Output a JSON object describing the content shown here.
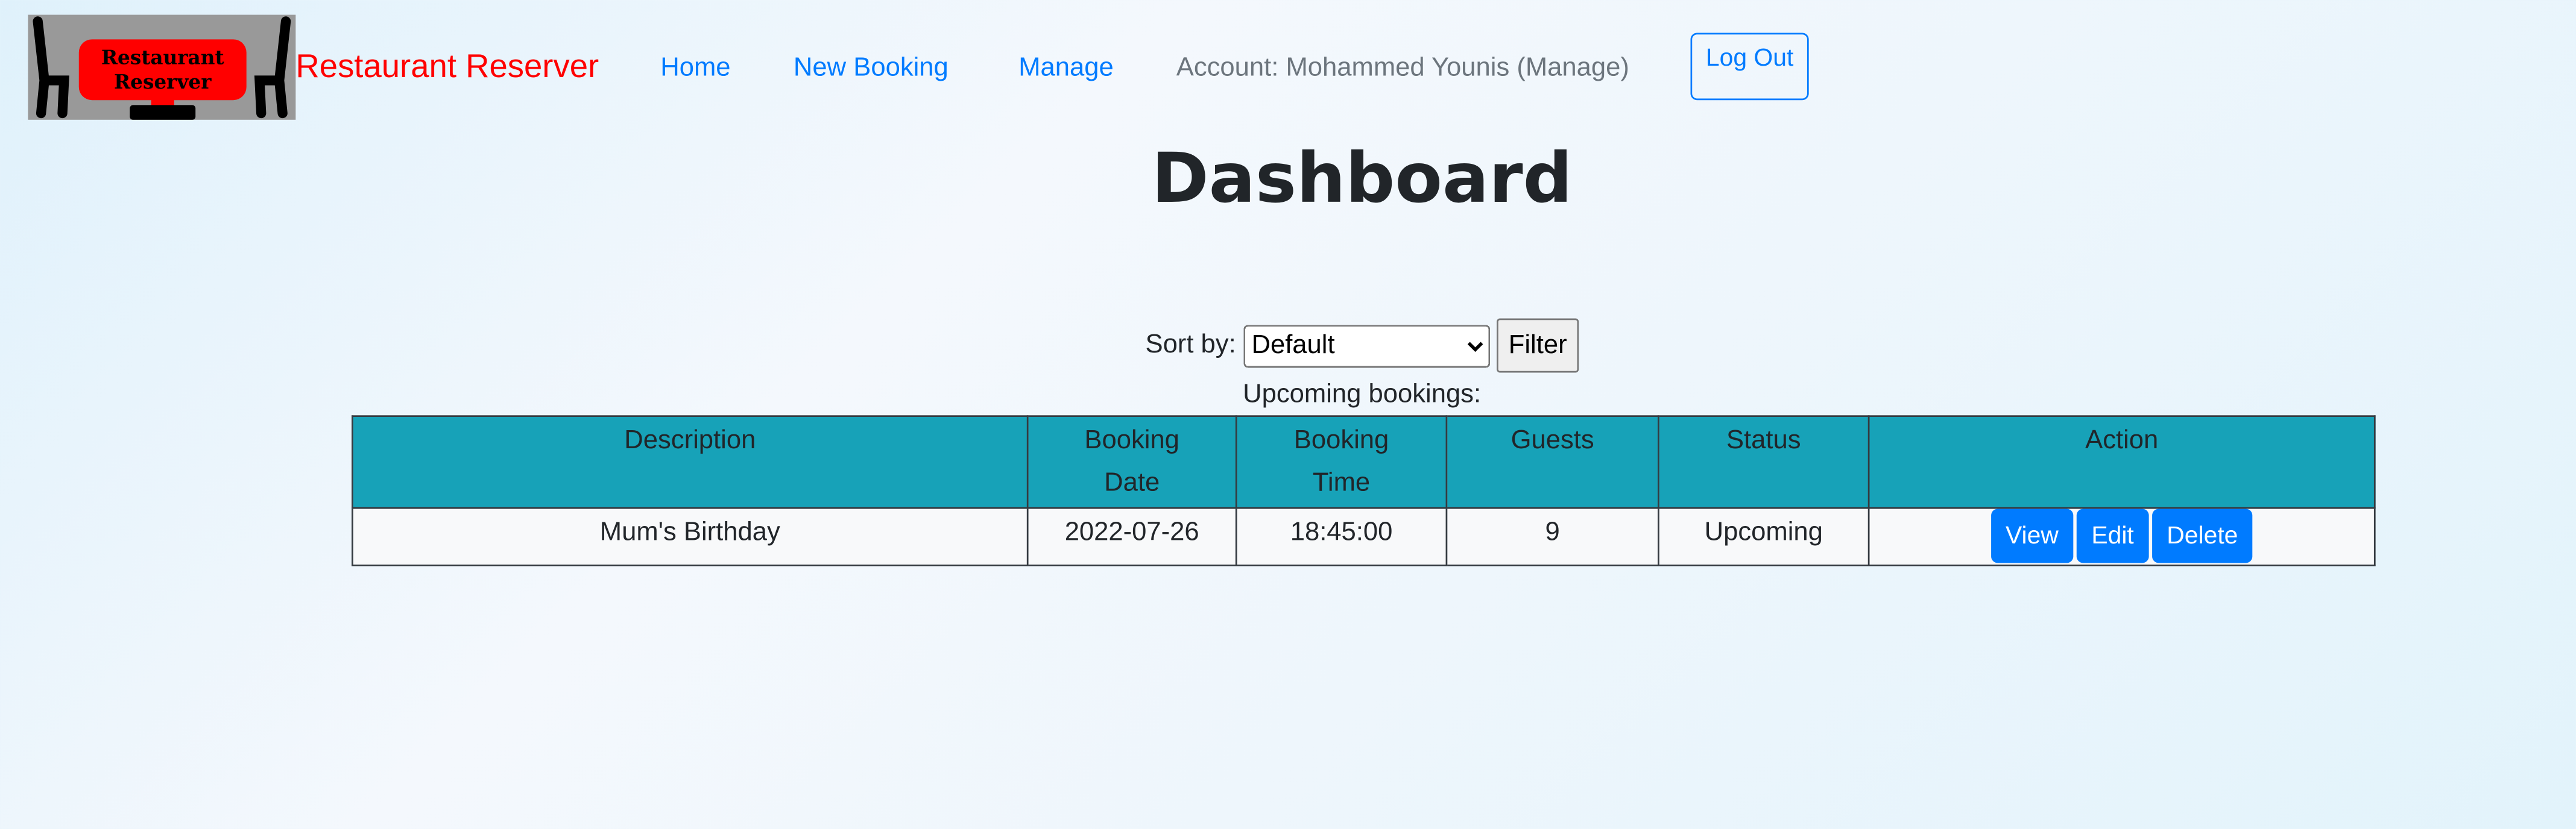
{
  "header": {
    "logo_text": "Restaurant Reserver",
    "brand": "Restaurant Reserver",
    "nav": {
      "home": "Home",
      "new_booking": "New Booking",
      "manage": "Manage",
      "account": "Account: Mohammed Younis (Manage)"
    },
    "logout": "Log Out"
  },
  "page_title": "Dashboard",
  "sort": {
    "label": "Sort by:",
    "selected": "Default",
    "filter_button": "Filter"
  },
  "table": {
    "caption": "Upcoming bookings:",
    "headers": [
      "Description",
      "Booking Date",
      "Booking Time",
      "Guests",
      "Status",
      "Action"
    ],
    "rows": [
      {
        "description": "Mum's Birthday",
        "date": "2022-07-26",
        "time": "18:45:00",
        "guests": "9",
        "status": "Upcoming",
        "actions": [
          "View",
          "Edit",
          "Delete"
        ]
      }
    ]
  },
  "colors": {
    "brand": "#ff0000",
    "link": "#007bff",
    "table_header": "#17a2b8",
    "button": "#007bff"
  }
}
